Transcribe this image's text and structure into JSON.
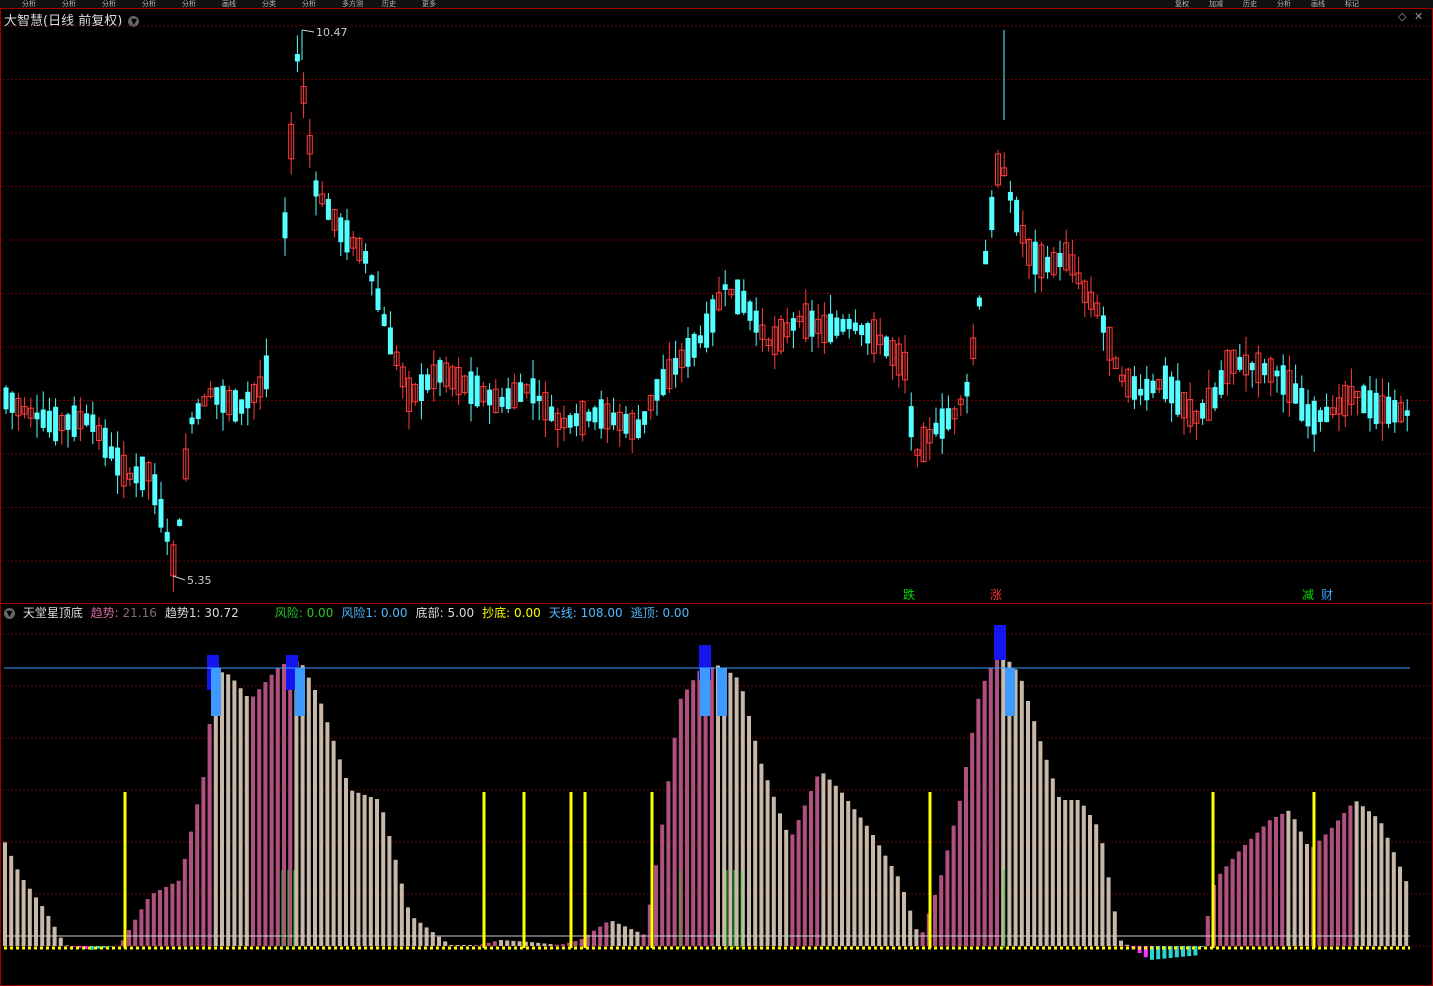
{
  "topbar": {
    "items": [
      "分析",
      "分析",
      "分析",
      "分析",
      "分析",
      "画线",
      "分类",
      "分析",
      "多方测",
      "历史",
      "更多"
    ],
    "right_items": [
      "复权",
      "加减",
      "历史",
      "分析",
      "画线",
      "标记"
    ]
  },
  "main_chart": {
    "title": "大智慧",
    "period": "(日线 前复权)",
    "high_label": "10.47",
    "low_label": "5.35",
    "markers": [
      {
        "text": "跌",
        "color": "#00dd00"
      },
      {
        "text": "涨",
        "color": "#ff3030"
      },
      {
        "text": "减",
        "color": "#00dd00"
      },
      {
        "text": "财",
        "color": "#3aa0ff"
      }
    ]
  },
  "indicator": {
    "name": "天堂星顶底",
    "fields": [
      {
        "label": "趋势:",
        "value": "21.16",
        "color": "#d36aa0"
      },
      {
        "label": "趋势1:",
        "value": "30.72",
        "color": "#dddddd"
      },
      {
        "label": "风险:",
        "value": "0.00",
        "color": "#22cc22"
      },
      {
        "label": "风险1:",
        "value": "0.00",
        "color": "#4fb8ff"
      },
      {
        "label": "底部:",
        "value": "5.00",
        "color": "#dddddd"
      },
      {
        "label": "抄底:",
        "value": "0.00",
        "color": "#ffff00"
      },
      {
        "label": "天线:",
        "value": "108.00",
        "color": "#4fb8ff"
      },
      {
        "label": "逃顶:",
        "value": "0.00",
        "color": "#4fb8ff"
      }
    ]
  },
  "colors": {
    "up": "#ff3b3b",
    "down": "#54ffff",
    "trend_up": "#b0507f",
    "trend_down": "#c8b8a8",
    "sky": "#3d9bff",
    "buy": "#ffff00",
    "grid": "#7a0000"
  },
  "chart_data": {
    "type": "candlestick",
    "high": 10.47,
    "low": 5.35
  }
}
